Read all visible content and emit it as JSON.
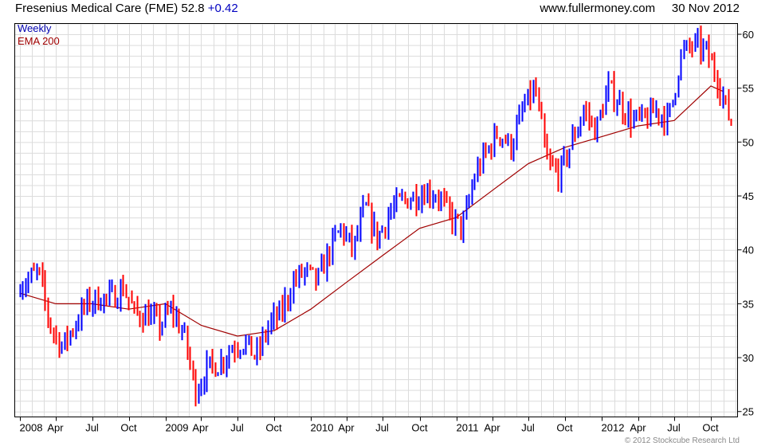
{
  "header": {
    "name": "Fresenius Medical Care (FME)",
    "price": "52.8",
    "change": "+0.42",
    "site": "www.fullermoney.com",
    "date": "30 Nov 2012"
  },
  "legend": {
    "series1": "Weekly",
    "series2": "EMA 200"
  },
  "copyright": "© 2012 Stockcube Research Ltd",
  "colors": {
    "up": "#0000ff",
    "down": "#ff0000",
    "ema": "#a00000",
    "grid": "#dcdcdc",
    "frame": "#000000"
  },
  "chart_data": {
    "type": "line",
    "title": "Fresenius Medical Care (FME)",
    "ylim": [
      24.5,
      61
    ],
    "y_ticks": [
      25,
      30,
      35,
      40,
      45,
      50,
      55,
      60
    ],
    "x_ticks": [
      "2008",
      "Apr",
      "Jul",
      "Oct",
      "2009",
      "Apr",
      "Jul",
      "Oct",
      "2010",
      "Apr",
      "Jul",
      "Oct",
      "2011",
      "Apr",
      "Jul",
      "Oct",
      "2012",
      "Apr",
      "Jul",
      "Oct"
    ],
    "grid": true,
    "bar_interval": "weekly",
    "series": [
      {
        "name": "Weekly",
        "style": "high-low bars",
        "x": [
          "2008-01",
          "2008-02",
          "2008-03",
          "2008-04",
          "2008-05",
          "2008-06",
          "2008-07",
          "2008-08",
          "2008-09",
          "2008-10",
          "2008-11",
          "2008-12",
          "2009-01",
          "2009-02",
          "2009-03",
          "2009-04",
          "2009-05",
          "2009-06",
          "2009-07",
          "2009-08",
          "2009-09",
          "2009-10",
          "2009-11",
          "2009-12",
          "2010-01",
          "2010-02",
          "2010-03",
          "2010-04",
          "2010-05",
          "2010-06",
          "2010-07",
          "2010-08",
          "2010-09",
          "2010-10",
          "2010-11",
          "2010-12",
          "2011-01",
          "2011-02",
          "2011-03",
          "2011-04",
          "2011-05",
          "2011-06",
          "2011-07",
          "2011-08",
          "2011-09",
          "2011-10",
          "2011-11",
          "2011-12",
          "2012-01",
          "2012-02",
          "2012-03",
          "2012-04",
          "2012-05",
          "2012-06",
          "2012-07",
          "2012-08",
          "2012-09",
          "2012-10",
          "2012-11"
        ],
        "values": [
          37,
          38,
          33,
          31,
          33,
          35,
          35.5,
          35.5,
          36.5,
          34,
          34,
          33,
          34.5,
          32,
          27,
          29,
          29.5,
          31,
          31.5,
          30,
          33,
          34,
          37,
          38,
          37,
          40,
          42,
          40,
          44,
          41,
          43.5,
          44.5,
          45,
          45.5,
          45,
          43,
          42,
          47,
          49,
          51,
          49.5,
          53,
          55,
          48,
          47,
          50,
          53,
          51,
          55,
          53.5,
          52,
          52,
          53,
          52,
          58,
          59,
          58.5,
          56,
          52
        ]
      },
      {
        "name": "EMA 200",
        "x": [
          "2008-01",
          "2008-04",
          "2008-07",
          "2008-10",
          "2009-01",
          "2009-04",
          "2009-07",
          "2009-10",
          "2010-01",
          "2010-04",
          "2010-07",
          "2010-10",
          "2011-01",
          "2011-04",
          "2011-07",
          "2011-10",
          "2012-01",
          "2012-04",
          "2012-07",
          "2012-10",
          "2012-11"
        ],
        "values": [
          36,
          35,
          35,
          34.5,
          35,
          33,
          32,
          32.5,
          34.5,
          37,
          39.5,
          42,
          43,
          45.5,
          48,
          49.5,
          50.5,
          51.5,
          52,
          55.2,
          54.7
        ]
      }
    ]
  }
}
